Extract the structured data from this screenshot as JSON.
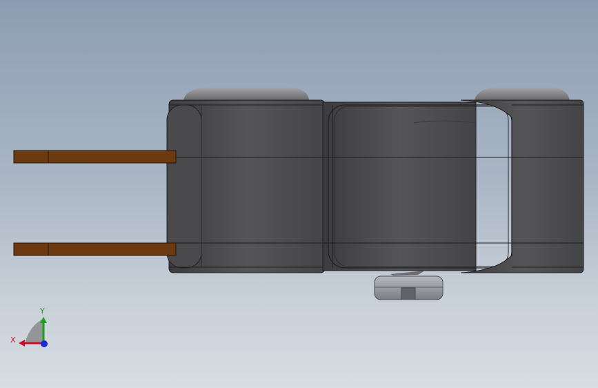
{
  "viewport": {
    "background_top": "#8c9db3",
    "background_bottom": "#d8dde2"
  },
  "model": {
    "body_color": "#4a4a4c",
    "lead_color": "#6b3a10",
    "cap_color": "#8a8a8c"
  },
  "triad": {
    "x_label": "X",
    "y_label": "Y",
    "x_color": "#c8102e",
    "y_color": "#1aa01a",
    "z_color": "#1a2ad8"
  }
}
